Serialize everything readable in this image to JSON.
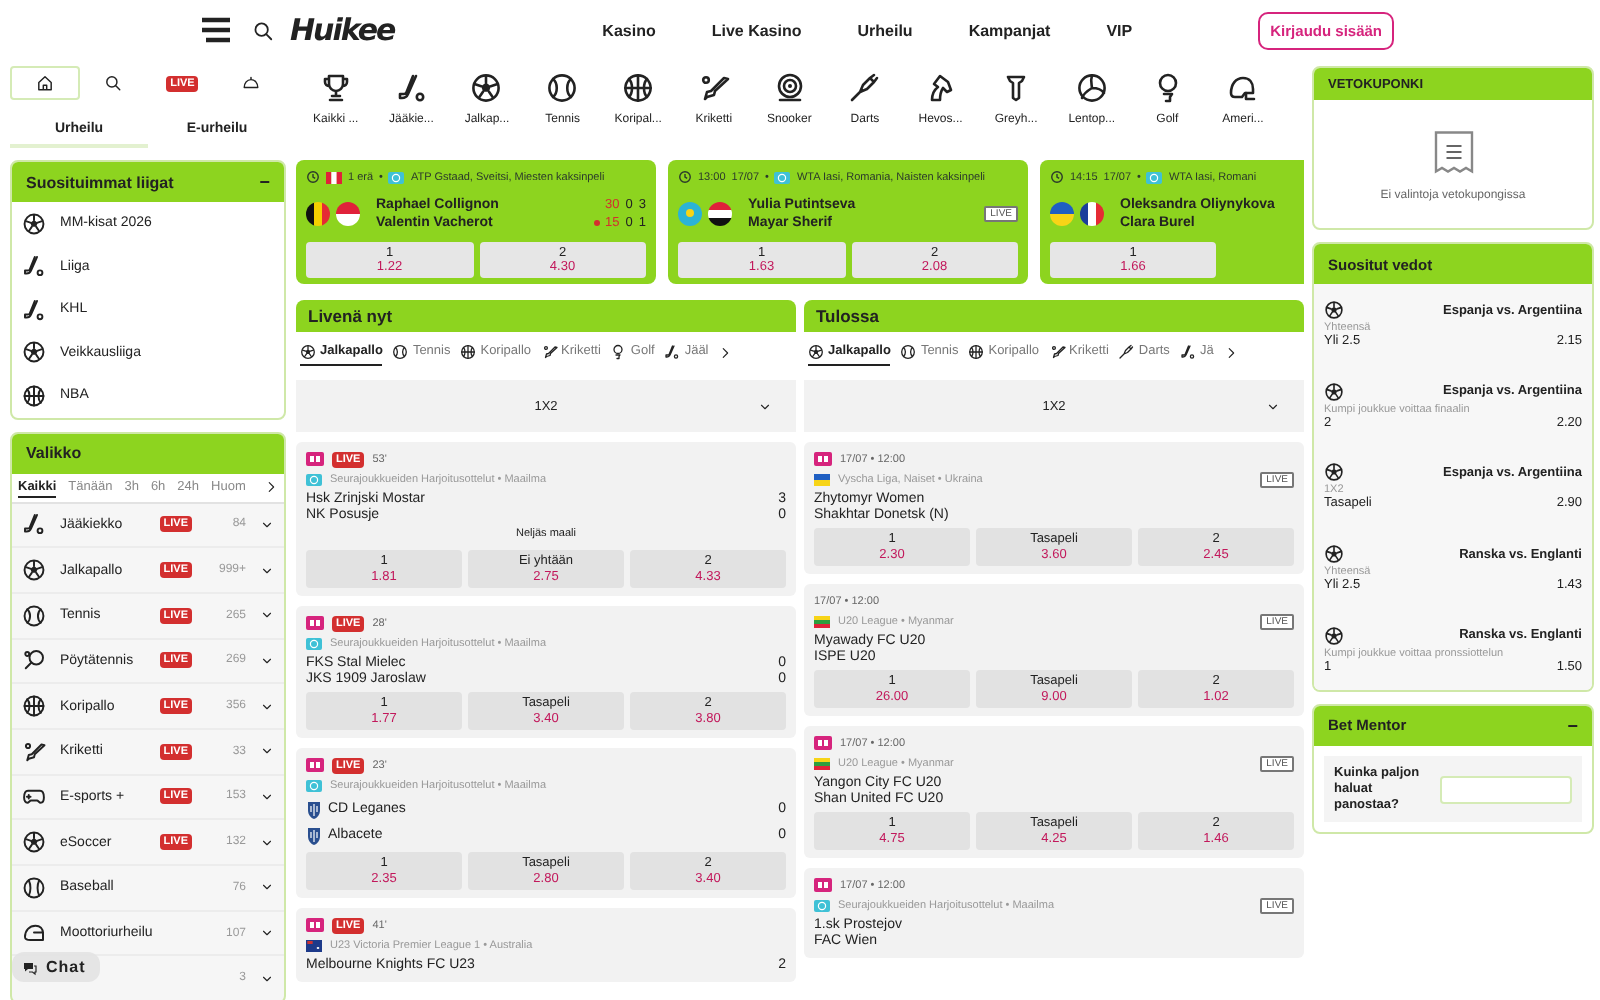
{
  "header": {
    "logo": "Huikee",
    "nav": [
      "Kasino",
      "Live Kasino",
      "Urheilu",
      "Kampanjat",
      "VIP"
    ],
    "login": "Kirjaudu sisään"
  },
  "left": {
    "quick_tabs": [
      {
        "kind": "home",
        "selected": true
      },
      {
        "kind": "search",
        "selected": false
      },
      {
        "kind": "live",
        "label": "LIVE",
        "selected": false
      },
      {
        "kind": "cap",
        "selected": false
      }
    ],
    "section_tabs": [
      {
        "label": "Urheilu",
        "selected": true
      },
      {
        "label": "E-urheilu",
        "selected": false
      }
    ],
    "popular_leagues": {
      "title": "Suosituimmat liigat",
      "toggle": "−",
      "items": [
        {
          "label": "MM-kisat 2026",
          "kind": "soccer"
        },
        {
          "label": "Liiga",
          "kind": "hockey"
        },
        {
          "label": "KHL",
          "kind": "hockey"
        },
        {
          "label": "Veikkausliiga",
          "kind": "soccer"
        },
        {
          "label": "NBA",
          "kind": "basketball"
        }
      ]
    },
    "menu": {
      "title": "Valikko",
      "filters": [
        {
          "label": "Kaikki",
          "selected": true
        },
        {
          "label": "Tänään",
          "selected": false
        },
        {
          "label": "3h",
          "selected": false
        },
        {
          "label": "6h",
          "selected": false
        },
        {
          "label": "24h",
          "selected": false
        },
        {
          "label": "Huom",
          "selected": false
        }
      ],
      "sports": [
        {
          "label": "Jääkiekko",
          "kind": "hockey",
          "badge": "LIVE",
          "count": "84"
        },
        {
          "label": "Jalkapallo",
          "kind": "soccer",
          "badge": "LIVE",
          "count": "999+"
        },
        {
          "label": "Tennis",
          "kind": "tennis",
          "badge": "LIVE",
          "count": "265"
        },
        {
          "label": "Pöytätennis",
          "kind": "tabletennis",
          "badge": "LIVE",
          "count": "269"
        },
        {
          "label": "Koripallo",
          "kind": "basketball",
          "badge": "LIVE",
          "count": "356"
        },
        {
          "label": "Kriketti",
          "kind": "cricket",
          "badge": "LIVE",
          "count": "33"
        },
        {
          "label": "E-sports +",
          "kind": "esports",
          "badge": "LIVE",
          "count": "153"
        },
        {
          "label": "eSoccer",
          "kind": "soccer",
          "badge": "LIVE",
          "count": "132"
        },
        {
          "label": "Baseball",
          "kind": "baseball",
          "count": "76"
        },
        {
          "label": "Moottoriurheilu",
          "kind": "motor",
          "count": "107"
        },
        {
          "count": "3"
        }
      ]
    }
  },
  "sport_bar": [
    {
      "label": "Kaikki ...",
      "kind": "trophy"
    },
    {
      "label": "Jääkie...",
      "kind": "hockey"
    },
    {
      "label": "Jalkap...",
      "kind": "soccer"
    },
    {
      "label": "Tennis",
      "kind": "tennis"
    },
    {
      "label": "Koripal...",
      "kind": "basketball"
    },
    {
      "label": "Kriketti",
      "kind": "cricket"
    },
    {
      "label": "Snooker",
      "kind": "snooker"
    },
    {
      "label": "Darts",
      "kind": "darts"
    },
    {
      "label": "Hevos...",
      "kind": "horse"
    },
    {
      "label": "Greyh...",
      "kind": "greyhound"
    },
    {
      "label": "Lentop...",
      "kind": "volleyball"
    },
    {
      "label": "Golf",
      "kind": "golf"
    },
    {
      "label": "Ameri...",
      "kind": "american"
    }
  ],
  "featured": [
    {
      "status": "1 erä",
      "status_flag": {
        "kind": "ca"
      },
      "separator": "•",
      "league": "ATP Gstaad, Sveitsi, Miesten kaksinpeli",
      "players": [
        {
          "name": "Raphael Collignon",
          "kind": "be",
          "serving": false,
          "points": "30",
          "games": [
            "0",
            "3"
          ]
        },
        {
          "name": "Valentin Vacherot",
          "kind": "mc",
          "serving": true,
          "points": "15",
          "games": [
            "0",
            "1"
          ]
        }
      ],
      "odds": [
        {
          "label": "1",
          "value": "1.22"
        },
        {
          "label": "2",
          "value": "4.30"
        }
      ]
    },
    {
      "time": "13:00",
      "date": "17/07",
      "separator": "•",
      "league": "WTA Iasi, Romania, Naisten kaksinpeli",
      "live_tag": "LIVE",
      "players": [
        {
          "name": "Yulia Putintseva",
          "kind": "kz"
        },
        {
          "name": "Mayar Sherif",
          "kind": "eg"
        }
      ],
      "odds": [
        {
          "label": "1",
          "value": "1.63"
        },
        {
          "label": "2",
          "value": "2.08"
        }
      ]
    },
    {
      "time": "14:15",
      "date": "17/07",
      "separator": "•",
      "league": "WTA Iasi, Romani",
      "players": [
        {
          "name": "Oleksandra Oliynykova",
          "kind": "ua"
        },
        {
          "name": "Clara Burel",
          "kind": "fr"
        }
      ],
      "odds": [
        {
          "label": "1",
          "value": "1.66"
        }
      ]
    }
  ],
  "live_now": {
    "title": "Livenä nyt",
    "tabs": [
      {
        "label": "Jalkapallo",
        "kind": "soccer",
        "selected": true
      },
      {
        "label": "Tennis",
        "kind": "tennis",
        "selected": false
      },
      {
        "label": "Koripallo",
        "kind": "basketball",
        "selected": false
      },
      {
        "label": "Kriketti",
        "kind": "cricket",
        "selected": false
      },
      {
        "label": "Golf",
        "kind": "golf",
        "selected": false
      },
      {
        "label": "Jääl",
        "kind": "hockey",
        "selected": false
      }
    ],
    "market": "1X2",
    "matches": [
      {
        "bet_builder": true,
        "live_badge": "LIVE",
        "time": "53'",
        "league_icon": {
          "kind": "globe"
        },
        "league": "Seurajoukkueiden Harjoitusottelut • Maailma",
        "teams": [
          {
            "name": "Hsk Zrinjski Mostar",
            "score": "3"
          },
          {
            "name": "NK Posusje",
            "score": "0"
          }
        ],
        "market_label": "Neljäs maali",
        "odds": [
          {
            "label": "1",
            "value": "1.81"
          },
          {
            "label": "Ei yhtään",
            "value": "2.75"
          },
          {
            "label": "2",
            "value": "4.33"
          }
        ]
      },
      {
        "bet_builder": true,
        "live_badge": "LIVE",
        "time": "28'",
        "league_icon": {
          "kind": "globe"
        },
        "league": "Seurajoukkueiden Harjoitusottelut • Maailma",
        "teams": [
          {
            "name": "FKS Stal Mielec",
            "score": "0"
          },
          {
            "name": "JKS 1909 Jaroslaw",
            "score": "0"
          }
        ],
        "odds": [
          {
            "label": "1",
            "value": "1.77"
          },
          {
            "label": "Tasapeli",
            "value": "3.40"
          },
          {
            "label": "2",
            "value": "3.80"
          }
        ]
      },
      {
        "bet_builder": true,
        "live_badge": "LIVE",
        "time": "23'",
        "league_icon": {
          "kind": "globe"
        },
        "league": "Seurajoukkueiden Harjoitusottelut • Maailma",
        "teams": [
          {
            "name": "CD Leganes",
            "score": "0",
            "crest": true
          },
          {
            "name": "Albacete",
            "score": "0",
            "crest": true
          }
        ],
        "odds": [
          {
            "label": "1",
            "value": "2.35"
          },
          {
            "label": "Tasapeli",
            "value": "2.80"
          },
          {
            "label": "2",
            "value": "3.40"
          }
        ]
      },
      {
        "bet_builder": true,
        "live_badge": "LIVE",
        "time": "41'",
        "league_icon": {
          "kind": "au"
        },
        "league": "U23 Victoria Premier League 1 • Australia",
        "teams": [
          {
            "name": "Melbourne Knights FC U23",
            "score": "2"
          }
        ]
      }
    ]
  },
  "upcoming": {
    "title": "Tulossa",
    "tabs": [
      {
        "label": "Jalkapallo",
        "kind": "soccer",
        "selected": true
      },
      {
        "label": "Tennis",
        "kind": "tennis",
        "selected": false
      },
      {
        "label": "Koripallo",
        "kind": "basketball",
        "selected": false
      },
      {
        "label": "Kriketti",
        "kind": "cricket",
        "selected": false
      },
      {
        "label": "Darts",
        "kind": "darts",
        "selected": false
      },
      {
        "label": "Jä",
        "kind": "hockey",
        "selected": false
      }
    ],
    "market": "1X2",
    "matches": [
      {
        "bet_builder": true,
        "time": "17/07 • 12:00",
        "league_icon": {
          "kind": "ua"
        },
        "league": "Vyscha Liga, Naiset • Ukraina",
        "live_tag": "LIVE",
        "teams": [
          {
            "name": "Zhytomyr Women"
          },
          {
            "name": "Shakhtar Donetsk (N)"
          }
        ],
        "odds": [
          {
            "label": "1",
            "value": "2.30"
          },
          {
            "label": "Tasapeli",
            "value": "3.60"
          },
          {
            "label": "2",
            "value": "2.45"
          }
        ]
      },
      {
        "bet_builder": false,
        "time": "17/07 • 12:00",
        "league_icon": {
          "kind": "mm"
        },
        "league": "U20 League • Myanmar",
        "live_tag": "LIVE",
        "teams": [
          {
            "name": "Myawady FC U20"
          },
          {
            "name": "ISPE U20"
          }
        ],
        "odds": [
          {
            "label": "1",
            "value": "26.00"
          },
          {
            "label": "Tasapeli",
            "value": "9.00"
          },
          {
            "label": "2",
            "value": "1.02"
          }
        ]
      },
      {
        "bet_builder": true,
        "time": "17/07 • 12:00",
        "league_icon": {
          "kind": "mm"
        },
        "league": "U20 League • Myanmar",
        "live_tag": "LIVE",
        "teams": [
          {
            "name": "Yangon City FC U20"
          },
          {
            "name": "Shan United FC U20"
          }
        ],
        "odds": [
          {
            "label": "1",
            "value": "4.75"
          },
          {
            "label": "Tasapeli",
            "value": "4.25"
          },
          {
            "label": "2",
            "value": "1.46"
          }
        ]
      },
      {
        "bet_builder": true,
        "time": "17/07 • 12:00",
        "league_icon": {
          "kind": "globe"
        },
        "league": "Seurajoukkueiden Harjoitusottelut • Maailma",
        "live_tag": "LIVE",
        "teams": [
          {
            "name": "1.sk Prostejov"
          },
          {
            "name": "FAC Wien"
          }
        ]
      }
    ]
  },
  "coupon": {
    "title": "VETOKUPONKI",
    "empty": "Ei valintoja vetokupongissa"
  },
  "popular_bets": {
    "title": "Suositut vedot",
    "items": [
      {
        "kind": "soccer",
        "match": "Espanja vs. Argentiina",
        "market": "Yhteensä",
        "pick": "Yli 2.5",
        "odds": "2.15"
      },
      {
        "kind": "soccer",
        "match": "Espanja vs. Argentiina",
        "market": "Kumpi joukkue voittaa finaalin",
        "pick": "2",
        "odds": "2.20"
      },
      {
        "kind": "soccer",
        "match": "Espanja vs. Argentiina",
        "market": "1X2",
        "pick": "Tasapeli",
        "odds": "2.90"
      },
      {
        "kind": "soccer",
        "match": "Ranska vs. Englanti",
        "market": "Yhteensä",
        "pick": "Yli 2.5",
        "odds": "1.43"
      },
      {
        "kind": "soccer",
        "match": "Ranska vs. Englanti",
        "market": "Kumpi joukkue voittaa pronssiottelun",
        "pick": "1",
        "odds": "1.50"
      }
    ]
  },
  "bet_mentor": {
    "title": "Bet Mentor",
    "toggle": "−",
    "question": "Kuinka paljon haluat panostaa?"
  },
  "chat": {
    "label": "Chat"
  }
}
